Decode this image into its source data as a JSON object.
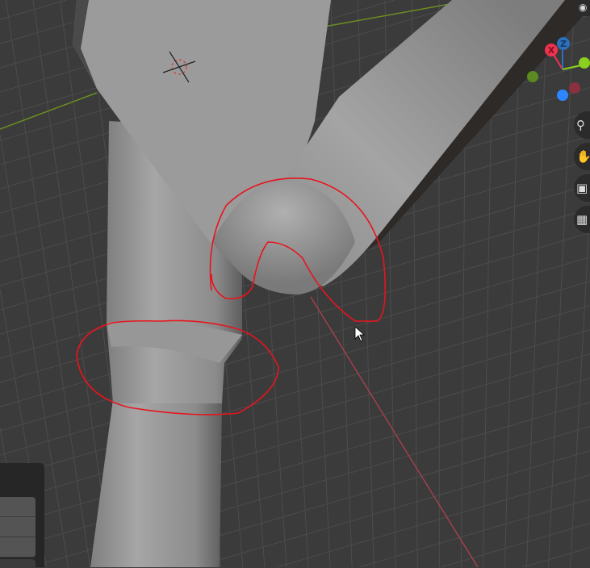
{
  "viewport": {
    "gizmo": {
      "x_label": "X",
      "z_label": "Z",
      "colors": {
        "x": "#f0334f",
        "y": "#8bd01f",
        "z": "#2d6fb8"
      }
    },
    "nav_buttons": [
      "zoom",
      "pan",
      "camera",
      "perspective"
    ],
    "annotation_color": "#e8141e"
  }
}
